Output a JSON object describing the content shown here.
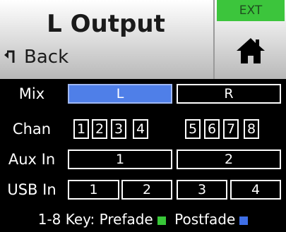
{
  "header": {
    "title": "L Output",
    "back_label": "Back",
    "ext_label": "EXT",
    "home_icon": "home-icon",
    "back_icon": "back-arrow-icon"
  },
  "rows": {
    "mix": {
      "label": "Mix",
      "options": [
        "L",
        "R"
      ],
      "selected": "L"
    },
    "chan": {
      "label": "Chan",
      "channels": [
        "1",
        "2",
        "3",
        "4",
        "5",
        "6",
        "7",
        "8"
      ]
    },
    "aux": {
      "label": "Aux In",
      "inputs": [
        "1",
        "2"
      ]
    },
    "usb": {
      "label": "USB In",
      "inputs": [
        "1",
        "2",
        "3",
        "4"
      ]
    }
  },
  "key": {
    "text": "1-8 Key: Prefade",
    "postfade": "Postfade",
    "prefade_color": "#38c738",
    "postfade_color": "#3f6fe6"
  },
  "colors": {
    "selected": "#4f7fe8",
    "ext_green": "#3cc53c"
  }
}
